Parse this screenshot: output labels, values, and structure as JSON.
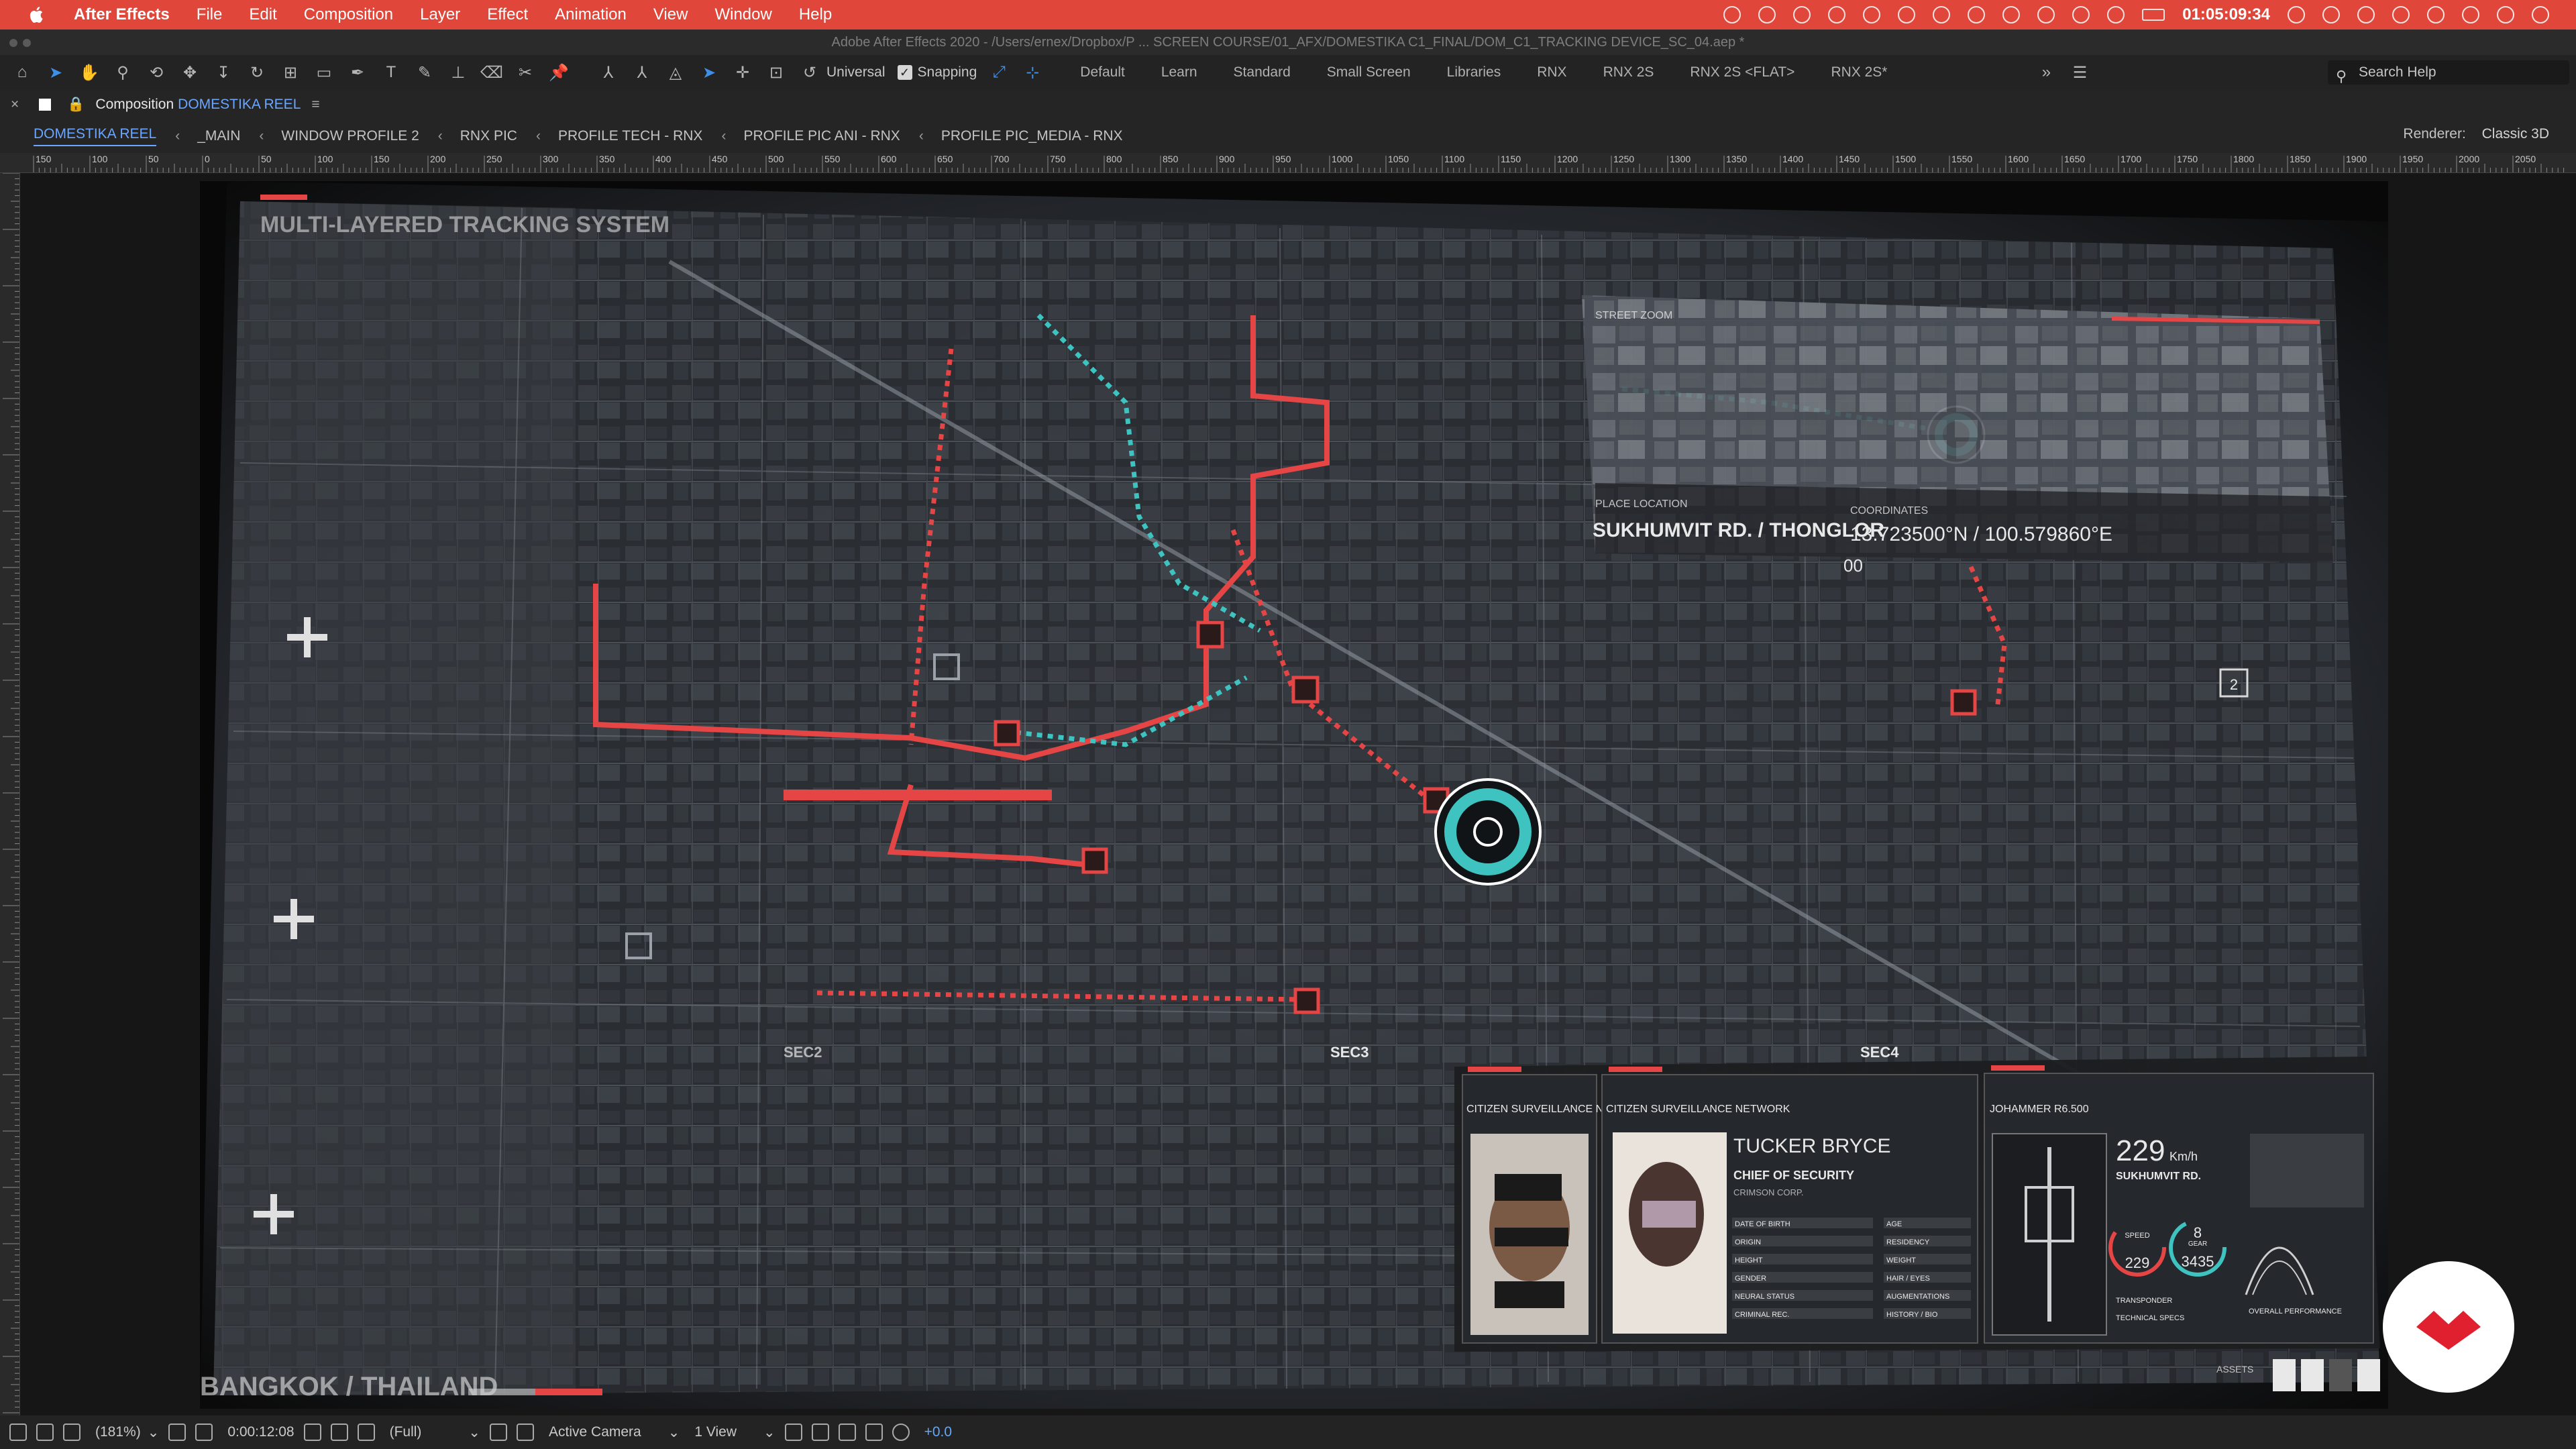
{
  "menubar": {
    "app_name": "After Effects",
    "items": [
      "File",
      "Edit",
      "Composition",
      "Layer",
      "Effect",
      "Animation",
      "View",
      "Window",
      "Help"
    ],
    "clock": "01:05:09:34"
  },
  "window_title": "Adobe After Effects 2020 - /Users/ernex/Dropbox/P ... SCREEN COURSE/01_AFX/DOMESTIKA C1_FINAL/DOM_C1_TRACKING DEVICE_SC_04.aep *",
  "toolbar": {
    "universal_label": "Universal",
    "snapping_label": "Snapping",
    "workspaces": [
      "Default",
      "Learn",
      "Standard",
      "Small Screen",
      "Libraries",
      "RNX",
      "RNX 2S",
      "RNX 2S <FLAT>",
      "RNX 2S*"
    ],
    "search_placeholder": "Search Help"
  },
  "comp_panel": {
    "label": "Composition",
    "name": "DOMESTIKA REEL",
    "breadcrumbs": [
      "DOMESTIKA REEL",
      "_MAIN",
      "WINDOW PROFILE 2",
      "RNX PIC",
      "PROFILE TECH - RNX",
      "PROFILE PIC ANI - RNX",
      "PROFILE PIC_MEDIA - RNX"
    ],
    "renderer_label": "Renderer:",
    "renderer_value": "Classic 3D"
  },
  "ruler": {
    "ticks": [
      "150",
      "100",
      "50",
      "0",
      "50",
      "100",
      "150",
      "200",
      "250",
      "300",
      "350",
      "400",
      "450",
      "500",
      "550",
      "600",
      "650",
      "700",
      "750",
      "800",
      "850",
      "900",
      "950",
      "1000",
      "1050",
      "1100",
      "1150",
      "1200",
      "1250",
      "1300",
      "1350",
      "1400",
      "1450",
      "1500",
      "1550",
      "1600",
      "1650",
      "1700",
      "1750",
      "1800",
      "1850",
      "1900",
      "1950",
      "2000",
      "2050"
    ]
  },
  "hud": {
    "map_title": "MULTI-LAYERED TRACKING SYSTEM",
    "zoom_label": "STREET ZOOM",
    "place_label": "PLACE LOCATION",
    "place_value": "SUKHUMVIT RD. / THONGLOR",
    "coord_label": "COORDINATES",
    "coord_value": "13.723500°N / 100.579860°E",
    "small_counter": "00",
    "marker_2": "2",
    "sec2": "SEC2",
    "sec3": "SEC3",
    "sec4": "SEC4",
    "location_footer": "BANGKOK / THAILAND",
    "card1_header": "CITIZEN SURVEILLANCE NE",
    "card2_header": "CITIZEN SURVEILLANCE NETWORK",
    "person_name": "TUCKER BRYCE",
    "person_role": "CHIEF OF SECURITY",
    "person_org": "CRIMSON CORP.",
    "card2_fields": [
      "DATE OF BIRTH",
      "ORIGIN",
      "HEIGHT",
      "GENDER",
      "NEURAL STATUS",
      "CRIMINAL REC."
    ],
    "card2_fields_right": [
      "AGE",
      "RESIDENCY",
      "WEIGHT",
      "HAIR / EYES",
      "AUGMENTATIONS",
      "HISTORY / BIO"
    ],
    "card3_header": "JOHAMMER R6.500",
    "speed": "229",
    "speed_unit": "Km/h",
    "street": "SUKHUMVIT RD.",
    "gauge1": "229",
    "gauge2_top": "8",
    "gauge2_bottom": "3435",
    "gauge1_label": "SPEED",
    "gauge2_label": "GEAR",
    "transponder_label": "TRANSPONDER",
    "tech_spec_label": "TECHNICAL SPECS",
    "performance_label": "OVERALL PERFORMANCE",
    "assets_label": "ASSETS"
  },
  "bottombar": {
    "zoom": "(181%)",
    "timecode": "0:00:12:08",
    "resolution": "(Full)",
    "camera": "Active Camera",
    "views": "1 View",
    "exposure": "+0.0"
  },
  "colors": {
    "menubar_red": "#e0473a",
    "accent_blue": "#6aa6ff",
    "hud_red": "#e64545",
    "hud_teal": "#3fc3c0"
  }
}
